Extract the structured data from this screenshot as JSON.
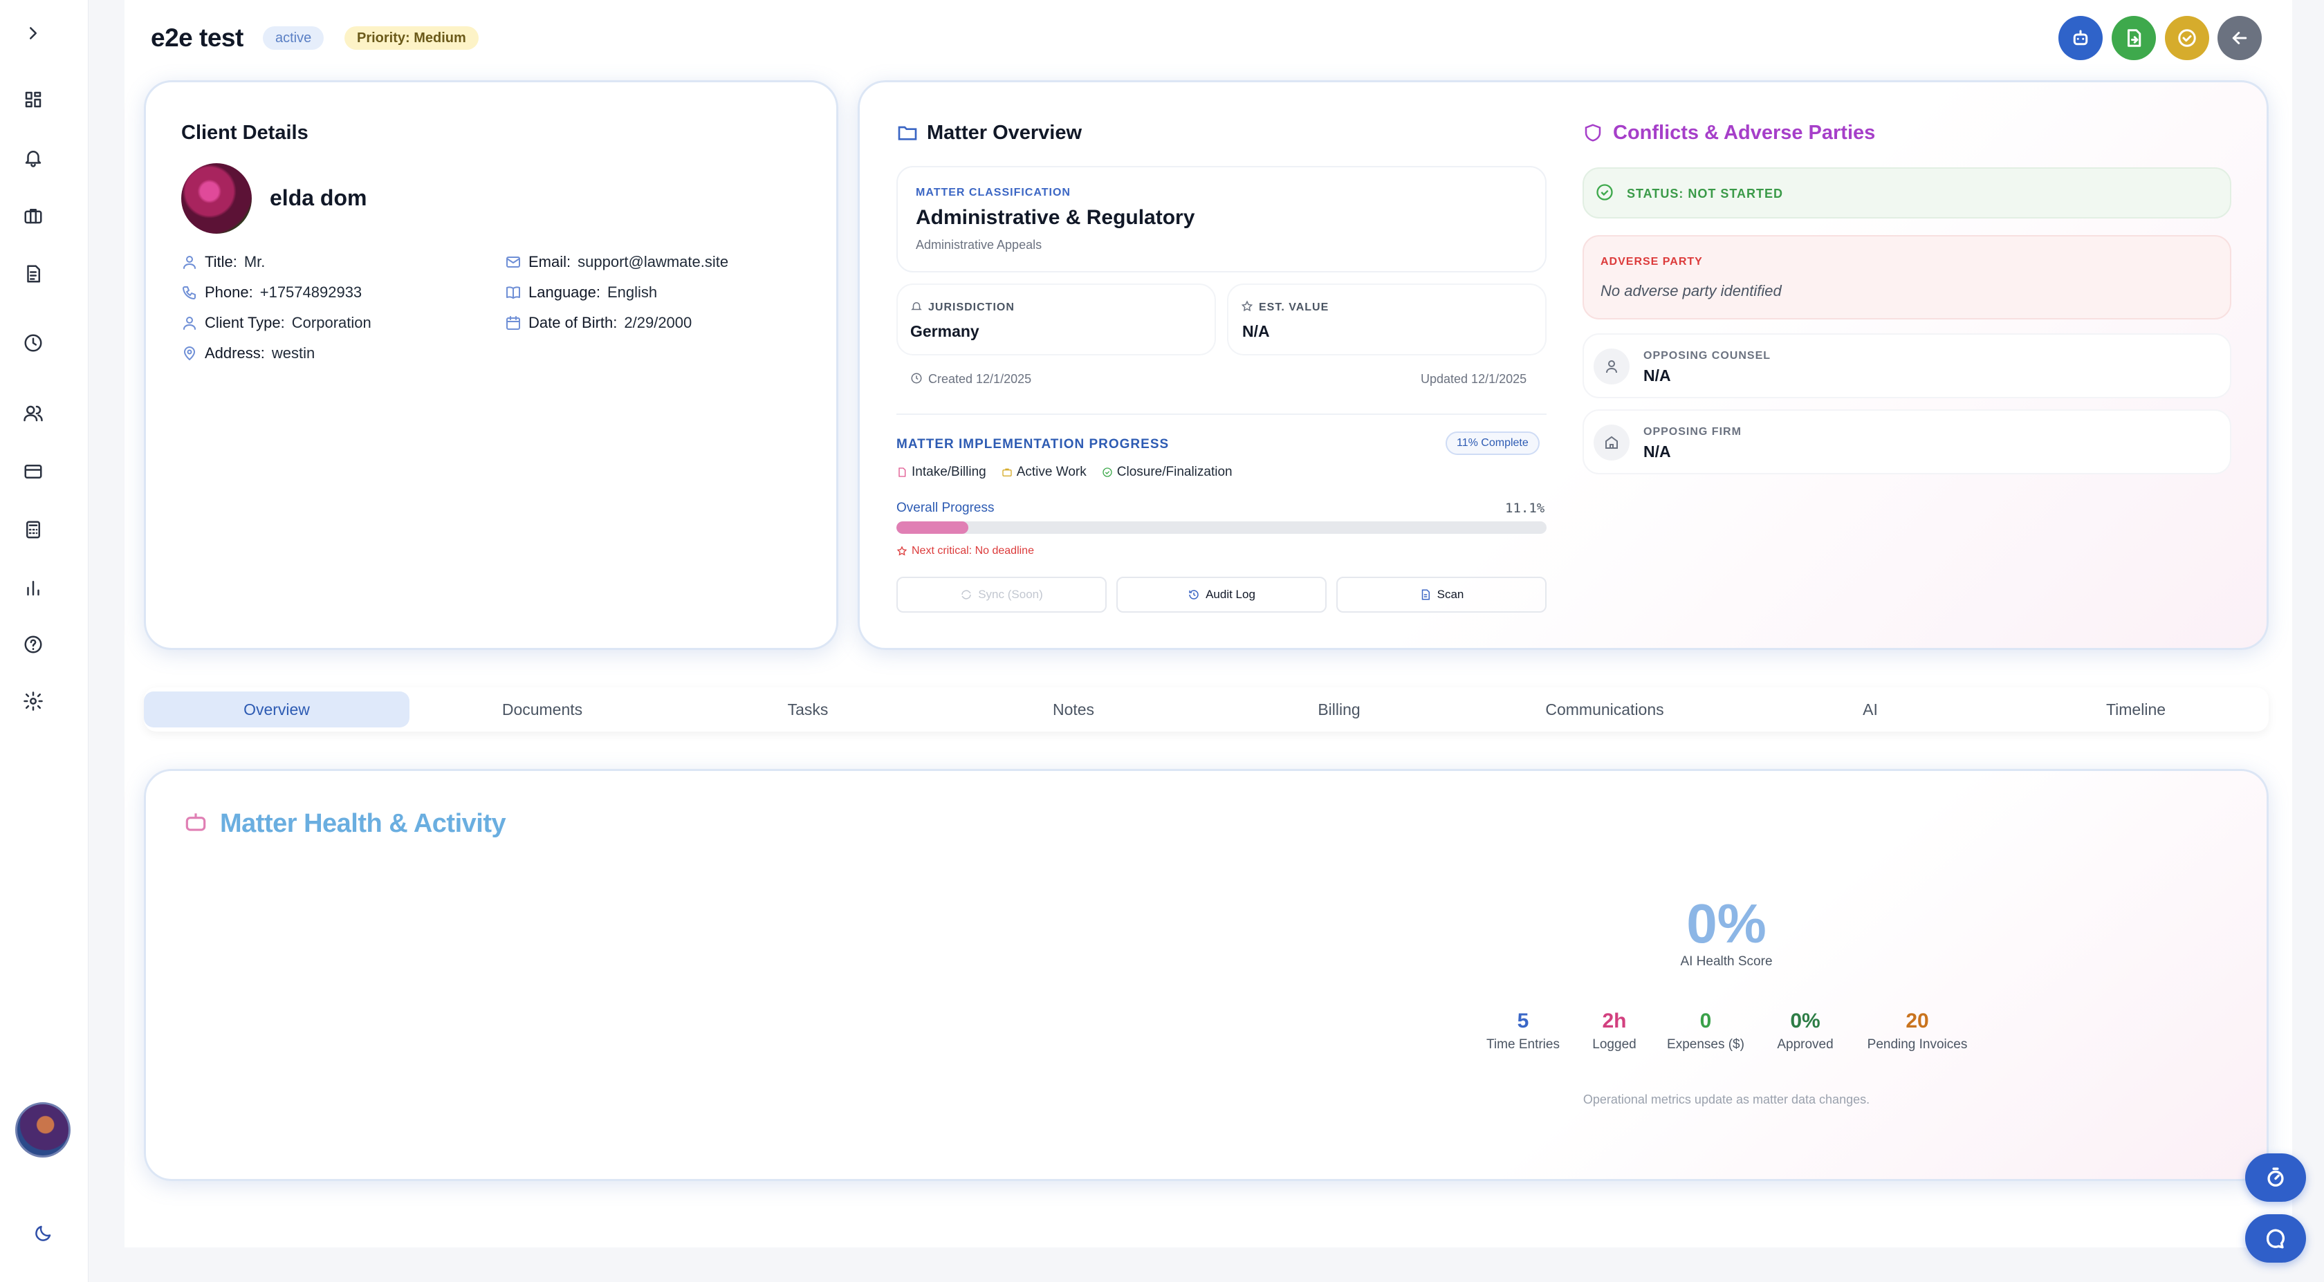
{
  "header": {
    "title": "e2e test",
    "status_badge": "active",
    "priority_badge": "Priority: Medium"
  },
  "sidebar": {
    "items": [
      {
        "icon": "chevron-right-icon"
      },
      {
        "icon": "dashboard-icon"
      },
      {
        "icon": "bell-icon"
      },
      {
        "icon": "briefcase-icon"
      },
      {
        "icon": "document-icon"
      },
      {
        "icon": "clock-icon"
      },
      {
        "icon": "users-icon"
      },
      {
        "icon": "credit-card-icon"
      },
      {
        "icon": "calculator-icon"
      },
      {
        "icon": "bar-chart-icon"
      },
      {
        "icon": "help-icon"
      },
      {
        "icon": "settings-icon"
      }
    ],
    "theme_toggle_icon": "moon-icon"
  },
  "header_actions": [
    {
      "icon": "robot-icon",
      "color": "#2f63c9"
    },
    {
      "icon": "file-export-icon",
      "color": "#3ea94c"
    },
    {
      "icon": "check-circle-icon",
      "color": "#d6ac2c"
    },
    {
      "icon": "arrow-left-icon",
      "color": "#6b7280"
    }
  ],
  "client": {
    "card_title": "Client Details",
    "name": "elda dom",
    "fields_left": [
      {
        "label": "Title:",
        "value": "Mr.",
        "icon": "user-icon"
      },
      {
        "label": "Phone:",
        "value": "+17574892933",
        "icon": "phone-icon"
      },
      {
        "label": "Client Type:",
        "value": "Corporation",
        "icon": "user-icon"
      },
      {
        "label": "Address:",
        "value": "westin",
        "icon": "map-pin-icon"
      }
    ],
    "fields_right": [
      {
        "label": "Email:",
        "value": "support@lawmate.site",
        "icon": "mail-icon"
      },
      {
        "label": "Language:",
        "value": "English",
        "icon": "book-icon"
      },
      {
        "label": "Date of Birth:",
        "value": "2/29/2000",
        "icon": "calendar-icon"
      }
    ]
  },
  "matter": {
    "title": "Matter Overview",
    "classification_label": "MATTER CLASSIFICATION",
    "classification": "Administrative & Regulatory",
    "sub_classification": "Administrative Appeals",
    "jurisdiction_label": "JURISDICTION",
    "jurisdiction": "Germany",
    "value_label": "EST. VALUE",
    "value": "N/A",
    "created": "Created 12/1/2025",
    "updated": "Updated 12/1/2025",
    "progress_title": "MATTER IMPLEMENTATION PROGRESS",
    "progress_badge": "11% Complete",
    "phases": [
      "Intake/Billing",
      "Active Work",
      "Closure/Finalization"
    ],
    "overall_label": "Overall Progress",
    "overall_value_text": "11.1%",
    "overall_fraction": 0.111,
    "next_critical": "Next critical: No deadline",
    "buttons": {
      "sync": "Sync (Soon)",
      "audit": "Audit Log",
      "scan": "Scan"
    }
  },
  "conflicts": {
    "title": "Conflicts & Adverse Parties",
    "status": "STATUS: NOT STARTED",
    "adverse_label": "ADVERSE PARTY",
    "adverse_value": "No adverse party identified",
    "counsel_label": "OPPOSING COUNSEL",
    "counsel_value": "N/A",
    "firm_label": "OPPOSING FIRM",
    "firm_value": "N/A"
  },
  "tabs": [
    "Overview",
    "Documents",
    "Tasks",
    "Notes",
    "Billing",
    "Communications",
    "AI",
    "Timeline"
  ],
  "active_tab": "Overview",
  "health": {
    "title": "Matter Health & Activity",
    "score": "0%",
    "score_label": "AI Health Score",
    "metrics": [
      {
        "value": "5",
        "label": "Time Entries",
        "color": "#3a67c7"
      },
      {
        "value": "2h",
        "label": "Logged",
        "color": "#d2407f"
      },
      {
        "value": "0",
        "label": "Expenses ($)",
        "color": "#3aa14a"
      },
      {
        "value": "0%",
        "label": "Approved",
        "color": "#2d7d46"
      },
      {
        "value": "20",
        "label": "Pending Invoices",
        "color": "#c9731e"
      }
    ],
    "footnote": "Operational metrics update as matter data changes."
  },
  "colors": {
    "accent": "#2f5fc9",
    "progress_fill": "#e07fb4",
    "health_title": "#6aaee0",
    "conflicts_title": "#a63fc9"
  }
}
